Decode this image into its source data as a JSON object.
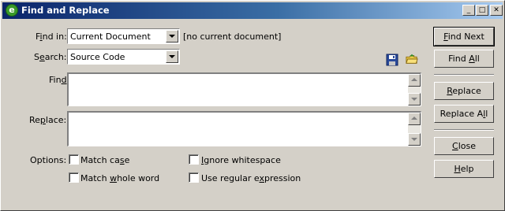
{
  "window": {
    "title": "Find and Replace",
    "controls": {
      "minimize": "_",
      "maximize": "□",
      "close": "✕"
    }
  },
  "find_in": {
    "label_pre": "F",
    "label_u": "i",
    "label_post": "nd in:",
    "value": "Current Document",
    "note": "[no current document]"
  },
  "search": {
    "label_pre": "S",
    "label_u": "e",
    "label_post": "arch:",
    "value": "Source Code"
  },
  "find_field": {
    "label_pre": "Fin",
    "label_u": "d",
    "label_post": ":",
    "value": ""
  },
  "replace_field": {
    "label_pre": "Re",
    "label_u": "p",
    "label_post": "lace:",
    "value": ""
  },
  "options": {
    "label": "Options:",
    "match_case": {
      "pre": "Match ca",
      "u": "s",
      "post": "e",
      "checked": false
    },
    "match_whole_word": {
      "pre": "Match ",
      "u": "w",
      "post": "hole word",
      "checked": false
    },
    "ignore_whitespace": {
      "pre": "",
      "u": "I",
      "post": "gnore whitespace",
      "checked": false
    },
    "use_regex": {
      "pre": "Use regular e",
      "u": "x",
      "post": "pression",
      "checked": false
    }
  },
  "buttons": {
    "find_next": {
      "pre": "",
      "u": "F",
      "post": "ind Next"
    },
    "find_all": {
      "pre": "Find ",
      "u": "A",
      "post": "ll"
    },
    "replace": {
      "pre": "",
      "u": "R",
      "post": "eplace"
    },
    "replace_all": {
      "pre": "Replace A",
      "u": "l",
      "post": "l"
    },
    "close": {
      "pre": "",
      "u": "C",
      "post": "lose"
    },
    "help": {
      "pre": "",
      "u": "H",
      "post": "elp"
    }
  },
  "icons": {
    "save_query": "floppy-disk-icon",
    "load_query": "open-folder-icon",
    "app": "dreamweaver-app-icon"
  },
  "colors": {
    "titlebar_start": "#0a246a",
    "titlebar_end": "#a6caf0",
    "dialog_bg": "#d4d0c8"
  }
}
